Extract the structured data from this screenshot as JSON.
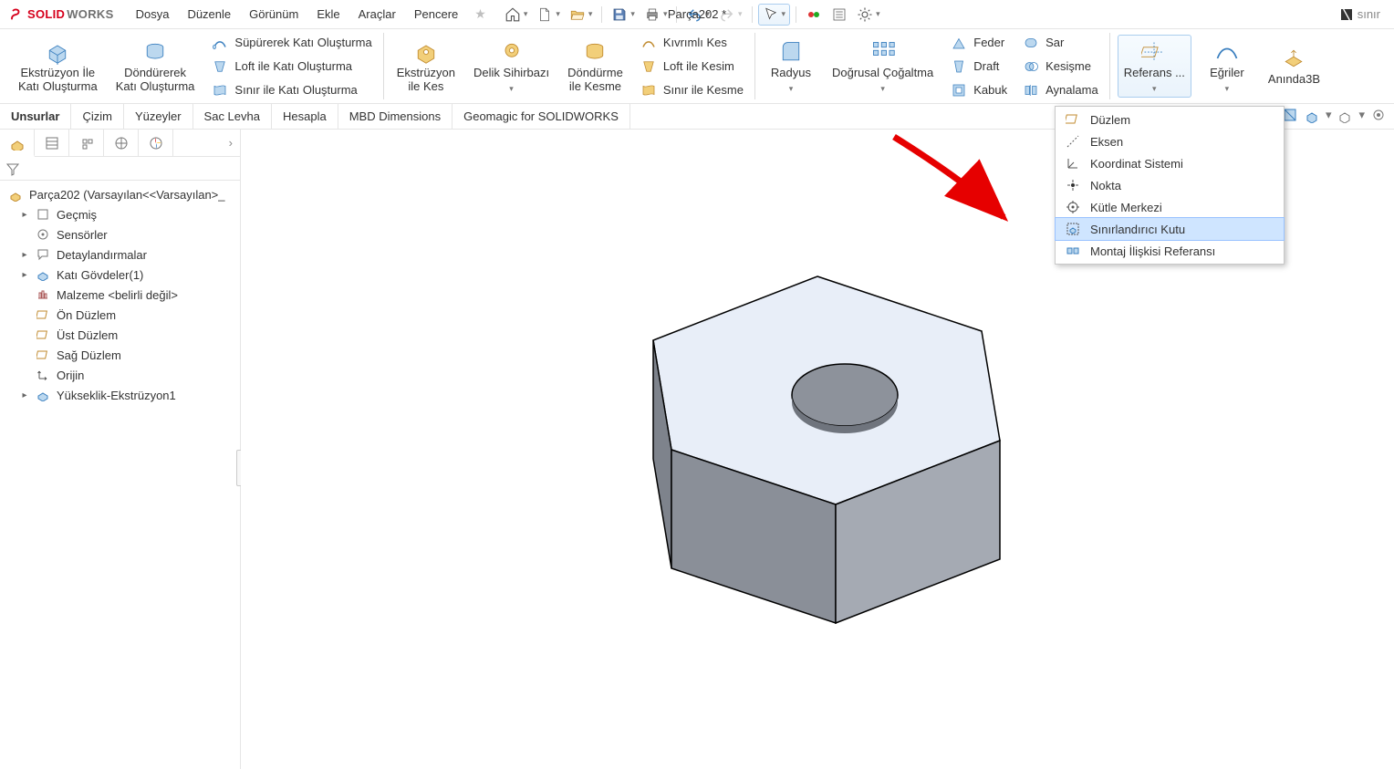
{
  "app": {
    "brand1": "SOLID",
    "brand2": "WORKS",
    "doc_title": "Parça202 *",
    "search_placeholder": "sınır"
  },
  "menu": {
    "items": [
      "Dosya",
      "Düzenle",
      "Görünüm",
      "Ekle",
      "Araçlar",
      "Pencere"
    ]
  },
  "ribbon": {
    "g1": {
      "extrude": "Ekstrüzyon İle\nKatı Oluşturma",
      "revolve": "Döndürerek\nKatı Oluşturma",
      "sweep": "Süpürerek Katı Oluşturma",
      "loft": "Loft ile Katı Oluşturma",
      "boundary": "Sınır ile Katı Oluşturma"
    },
    "g2": {
      "extcut": "Ekstrüzyon\nile Kes",
      "holewiz": "Delik Sihirbazı",
      "revcut": "Döndürme\nile Kesme",
      "wrapcut": "Kıvrımlı Kes",
      "loftcut": "Loft ile Kesim",
      "boundcut": "Sınır ile Kesme"
    },
    "g3": {
      "fillet": "Radyus",
      "pattern": "Doğrusal Çoğaltma",
      "feather": "Feder",
      "draft": "Draft",
      "shell": "Kabuk",
      "wrap": "Sar",
      "intersect": "Kesişme",
      "mirror": "Aynalama"
    },
    "g4": {
      "refgeo": "Referans ...",
      "curves": "Eğriler",
      "instant3d": "Anında3B"
    }
  },
  "tabs": {
    "items": [
      "Unsurlar",
      "Çizim",
      "Yüzeyler",
      "Sac Levha",
      "Hesapla",
      "MBD Dimensions",
      "Geomagic for SOLIDWORKS"
    ]
  },
  "tree": {
    "root": "Parça202  (Varsayılan<<Varsayılan>_",
    "items": [
      {
        "label": "Geçmiş",
        "expand": true
      },
      {
        "label": "Sensörler",
        "expand": false
      },
      {
        "label": "Detaylandırmalar",
        "expand": true
      },
      {
        "label": "Katı Gövdeler(1)",
        "expand": true
      },
      {
        "label": "Malzeme <belirli değil>",
        "expand": false
      },
      {
        "label": "Ön Düzlem",
        "expand": false
      },
      {
        "label": "Üst Düzlem",
        "expand": false
      },
      {
        "label": "Sağ Düzlem",
        "expand": false
      },
      {
        "label": "Orijin",
        "expand": false
      },
      {
        "label": "Yükseklik-Ekstrüzyon1",
        "expand": true
      }
    ]
  },
  "dropdown": {
    "items": [
      {
        "label": "Düzlem"
      },
      {
        "label": "Eksen"
      },
      {
        "label": "Koordinat Sistemi"
      },
      {
        "label": "Nokta"
      },
      {
        "label": "Kütle Merkezi"
      },
      {
        "label": "Sınırlandırıcı Kutu",
        "hover": true
      },
      {
        "label": "Montaj İlişkisi Referansı"
      }
    ]
  }
}
